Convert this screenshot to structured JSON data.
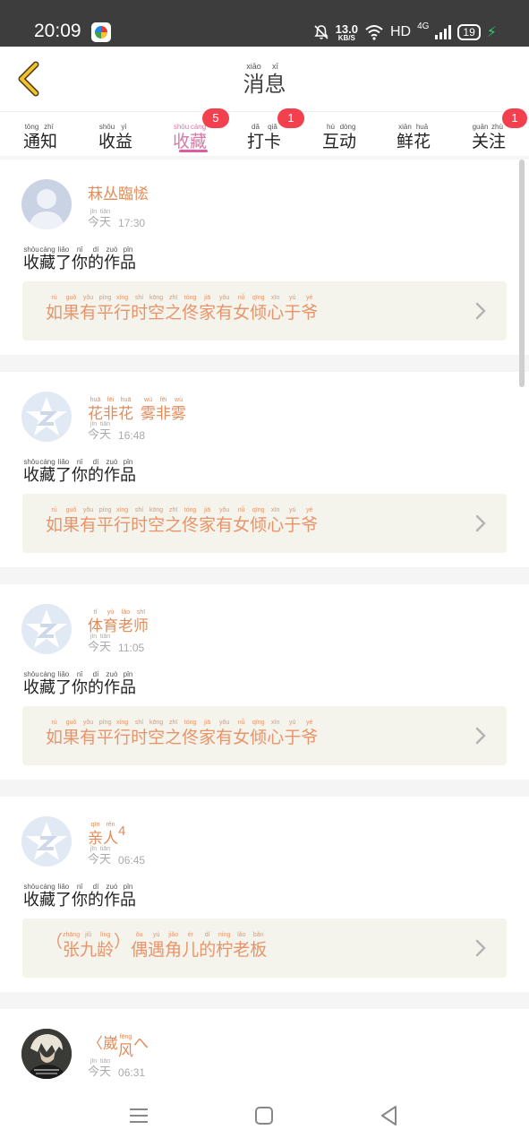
{
  "status_bar": {
    "time": "20:09",
    "net_speed": "13.0",
    "net_unit": "KB/S",
    "hd": "HD",
    "network": "4G",
    "battery": "19",
    "icons": [
      "mute-bell-icon",
      "wifi-icon",
      "signal-icon",
      "battery-icon",
      "charging-icon"
    ]
  },
  "header": {
    "title": [
      {
        "ch": "消",
        "py": "xiāo"
      },
      {
        "ch": "息",
        "py": "xī"
      }
    ],
    "back_icon": "chevron-left-icon",
    "accent": "#f2c230"
  },
  "tabs": [
    {
      "id": "notice",
      "chars": [
        {
          "ch": "通",
          "py": "tōng"
        },
        {
          "ch": "知",
          "py": "zhī"
        }
      ],
      "badge": ""
    },
    {
      "id": "income",
      "chars": [
        {
          "ch": "收",
          "py": "shōu"
        },
        {
          "ch": "益",
          "py": "yì"
        }
      ],
      "badge": ""
    },
    {
      "id": "collect",
      "chars": [
        {
          "ch": "收",
          "py": "shōu"
        },
        {
          "ch": "藏",
          "py": "cáng"
        }
      ],
      "badge": "5",
      "active": true
    },
    {
      "id": "checkin",
      "chars": [
        {
          "ch": "打",
          "py": "dǎ"
        },
        {
          "ch": "卡",
          "py": "qiǎ"
        }
      ],
      "badge": "1"
    },
    {
      "id": "interact",
      "chars": [
        {
          "ch": "互",
          "py": "hù"
        },
        {
          "ch": "动",
          "py": "dòng"
        }
      ],
      "badge": ""
    },
    {
      "id": "flower",
      "chars": [
        {
          "ch": "鲜",
          "py": "xiān"
        },
        {
          "ch": "花",
          "py": "huā"
        }
      ],
      "badge": ""
    },
    {
      "id": "follow",
      "chars": [
        {
          "ch": "关",
          "py": "guān"
        },
        {
          "ch": "注",
          "py": "zhù"
        }
      ],
      "badge": "1"
    }
  ],
  "colors": {
    "active_tab": "#d77aa6",
    "badge": "#f3404e",
    "username": "#e28c5a",
    "work_title": "#e8946a",
    "work_bg": "#f4f4ec"
  },
  "feed": [
    {
      "avatar": "default-person-avatar",
      "name": [
        {
          "ch": "菻",
          "py": ""
        },
        {
          "ch": "丛",
          "py": ""
        },
        {
          "ch": "臨",
          "py": ""
        },
        {
          "ch": "恡",
          "py": ""
        }
      ],
      "day": [
        {
          "ch": "今",
          "py": "jīn"
        },
        {
          "ch": "天",
          "py": "tiān"
        }
      ],
      "time": "17:30",
      "action": [
        {
          "ch": "收",
          "py": "shōu"
        },
        {
          "ch": "藏",
          "py": "cáng"
        },
        {
          "ch": "了",
          "py": "liǎo"
        },
        {
          "ch": "你",
          "py": "nǐ"
        },
        {
          "ch": "的",
          "py": "dí"
        },
        {
          "ch": "作",
          "py": "zuò"
        },
        {
          "ch": "品",
          "py": "pǐn"
        }
      ],
      "work": [
        {
          "ch": "如",
          "py": "rú"
        },
        {
          "ch": "果",
          "py": "guǒ"
        },
        {
          "ch": "有",
          "py": "yǒu"
        },
        {
          "ch": "平",
          "py": "píng"
        },
        {
          "ch": "行",
          "py": "xíng"
        },
        {
          "ch": "时",
          "py": "shí"
        },
        {
          "ch": "空",
          "py": "kōng"
        },
        {
          "ch": "之",
          "py": "zhī"
        },
        {
          "ch": "佟",
          "py": "tóng"
        },
        {
          "ch": "家",
          "py": "jiā"
        },
        {
          "ch": "有",
          "py": "yǒu"
        },
        {
          "ch": "女",
          "py": "nǚ"
        },
        {
          "ch": "倾",
          "py": "qīng"
        },
        {
          "ch": "心",
          "py": "xīn"
        },
        {
          "ch": "于",
          "py": "yú"
        },
        {
          "ch": "爷",
          "py": "yé"
        }
      ]
    },
    {
      "avatar": "qq-default-avatar",
      "name": [
        {
          "ch": "花",
          "py": "huā"
        },
        {
          "ch": "非",
          "py": "fēi"
        },
        {
          "ch": "花",
          "py": "huā"
        },
        {
          "ch": " ",
          "py": ""
        },
        {
          "ch": "雾",
          "py": "wù"
        },
        {
          "ch": "非",
          "py": "fēi"
        },
        {
          "ch": "雾",
          "py": "wù"
        }
      ],
      "day": [
        {
          "ch": "今",
          "py": "jīn"
        },
        {
          "ch": "天",
          "py": "tiān"
        }
      ],
      "time": "16:48",
      "action": [
        {
          "ch": "收",
          "py": "shōu"
        },
        {
          "ch": "藏",
          "py": "cáng"
        },
        {
          "ch": "了",
          "py": "liǎo"
        },
        {
          "ch": "你",
          "py": "nǐ"
        },
        {
          "ch": "的",
          "py": "dí"
        },
        {
          "ch": "作",
          "py": "zuò"
        },
        {
          "ch": "品",
          "py": "pǐn"
        }
      ],
      "work": [
        {
          "ch": "如",
          "py": "rú"
        },
        {
          "ch": "果",
          "py": "guǒ"
        },
        {
          "ch": "有",
          "py": "yǒu"
        },
        {
          "ch": "平",
          "py": "píng"
        },
        {
          "ch": "行",
          "py": "xíng"
        },
        {
          "ch": "时",
          "py": "shí"
        },
        {
          "ch": "空",
          "py": "kōng"
        },
        {
          "ch": "之",
          "py": "zhī"
        },
        {
          "ch": "佟",
          "py": "tóng"
        },
        {
          "ch": "家",
          "py": "jiā"
        },
        {
          "ch": "有",
          "py": "yǒu"
        },
        {
          "ch": "女",
          "py": "nǚ"
        },
        {
          "ch": "倾",
          "py": "qīng"
        },
        {
          "ch": "心",
          "py": "xīn"
        },
        {
          "ch": "于",
          "py": "yú"
        },
        {
          "ch": "爷",
          "py": "yé"
        }
      ]
    },
    {
      "avatar": "qq-default-avatar",
      "name": [
        {
          "ch": "体",
          "py": "tǐ"
        },
        {
          "ch": "育",
          "py": "yù"
        },
        {
          "ch": "老",
          "py": "lǎo"
        },
        {
          "ch": "师",
          "py": "shī"
        }
      ],
      "day": [
        {
          "ch": "今",
          "py": "jīn"
        },
        {
          "ch": "天",
          "py": "tiān"
        }
      ],
      "time": "11:05",
      "action": [
        {
          "ch": "收",
          "py": "shōu"
        },
        {
          "ch": "藏",
          "py": "cáng"
        },
        {
          "ch": "了",
          "py": "liǎo"
        },
        {
          "ch": "你",
          "py": "nǐ"
        },
        {
          "ch": "的",
          "py": "dí"
        },
        {
          "ch": "作",
          "py": "zuò"
        },
        {
          "ch": "品",
          "py": "pǐn"
        }
      ],
      "work": [
        {
          "ch": "如",
          "py": "rú"
        },
        {
          "ch": "果",
          "py": "guǒ"
        },
        {
          "ch": "有",
          "py": "yǒu"
        },
        {
          "ch": "平",
          "py": "píng"
        },
        {
          "ch": "行",
          "py": "xíng"
        },
        {
          "ch": "时",
          "py": "shí"
        },
        {
          "ch": "空",
          "py": "kōng"
        },
        {
          "ch": "之",
          "py": "zhī"
        },
        {
          "ch": "佟",
          "py": "tóng"
        },
        {
          "ch": "家",
          "py": "jiā"
        },
        {
          "ch": "有",
          "py": "yǒu"
        },
        {
          "ch": "女",
          "py": "nǚ"
        },
        {
          "ch": "倾",
          "py": "qīng"
        },
        {
          "ch": "心",
          "py": "xīn"
        },
        {
          "ch": "于",
          "py": "yú"
        },
        {
          "ch": "爷",
          "py": "yé"
        }
      ]
    },
    {
      "avatar": "qq-default-avatar",
      "name": [
        {
          "ch": "亲",
          "py": "qīn"
        },
        {
          "ch": "人",
          "py": "rén"
        },
        {
          "ch": "4",
          "py": ""
        }
      ],
      "day": [
        {
          "ch": "今",
          "py": "jīn"
        },
        {
          "ch": "天",
          "py": "tiān"
        }
      ],
      "time": "06:45",
      "action": [
        {
          "ch": "收",
          "py": "shōu"
        },
        {
          "ch": "藏",
          "py": "cáng"
        },
        {
          "ch": "了",
          "py": "liǎo"
        },
        {
          "ch": "你",
          "py": "nǐ"
        },
        {
          "ch": "的",
          "py": "dí"
        },
        {
          "ch": "作",
          "py": "zuò"
        },
        {
          "ch": "品",
          "py": "pǐn"
        }
      ],
      "work": [
        {
          "ch": "（",
          "py": ""
        },
        {
          "ch": "张",
          "py": "zhāng"
        },
        {
          "ch": "九",
          "py": "jiǔ"
        },
        {
          "ch": "龄",
          "py": "líng"
        },
        {
          "ch": "）",
          "py": ""
        },
        {
          "ch": "偶",
          "py": "ǒu"
        },
        {
          "ch": "遇",
          "py": "yù"
        },
        {
          "ch": "角",
          "py": "jiǎo"
        },
        {
          "ch": "儿",
          "py": "ér"
        },
        {
          "ch": "的",
          "py": "dí"
        },
        {
          "ch": "柠",
          "py": "níng"
        },
        {
          "ch": "老",
          "py": "lǎo"
        },
        {
          "ch": "板",
          "py": "bǎn"
        }
      ]
    },
    {
      "avatar": "anime-character-avatar",
      "name": [
        {
          "ch": "〈",
          "py": ""
        },
        {
          "ch": "崴",
          "py": ""
        },
        {
          "ch": "风",
          "py": "fēng"
        },
        {
          "ch": "へ",
          "py": ""
        }
      ],
      "day": [
        {
          "ch": "今",
          "py": "jīn"
        },
        {
          "ch": "天",
          "py": "tiān"
        }
      ],
      "time": "06:31",
      "action": [],
      "work": []
    }
  ],
  "nav_bar": {
    "icons": [
      "menu-icon",
      "home-square-icon",
      "back-triangle-icon"
    ]
  }
}
